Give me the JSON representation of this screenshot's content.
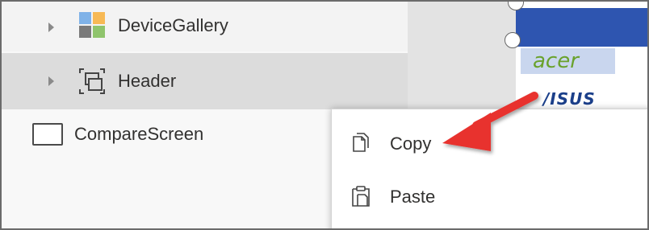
{
  "tree": {
    "items": [
      {
        "label": "DeviceGallery",
        "icon": "gallery-icon",
        "expandable": true
      },
      {
        "label": "Header",
        "icon": "group-icon",
        "expandable": true,
        "selected": true
      },
      {
        "label": "CompareScreen",
        "icon": "screen-icon",
        "expandable": false
      }
    ]
  },
  "canvas": {
    "logos": [
      {
        "name": "acer",
        "text": "acer",
        "color": "#6aa22c"
      },
      {
        "name": "asus",
        "text": "/ISUS",
        "color": "#1b3f8a"
      }
    ],
    "header_bar_color": "#2e55b0"
  },
  "context_menu": {
    "items": [
      {
        "label": "Copy",
        "icon": "copy-icon"
      },
      {
        "label": "Paste",
        "icon": "paste-icon"
      }
    ]
  },
  "annotation": {
    "arrow_color": "#e8312f",
    "points_to": "Copy"
  }
}
